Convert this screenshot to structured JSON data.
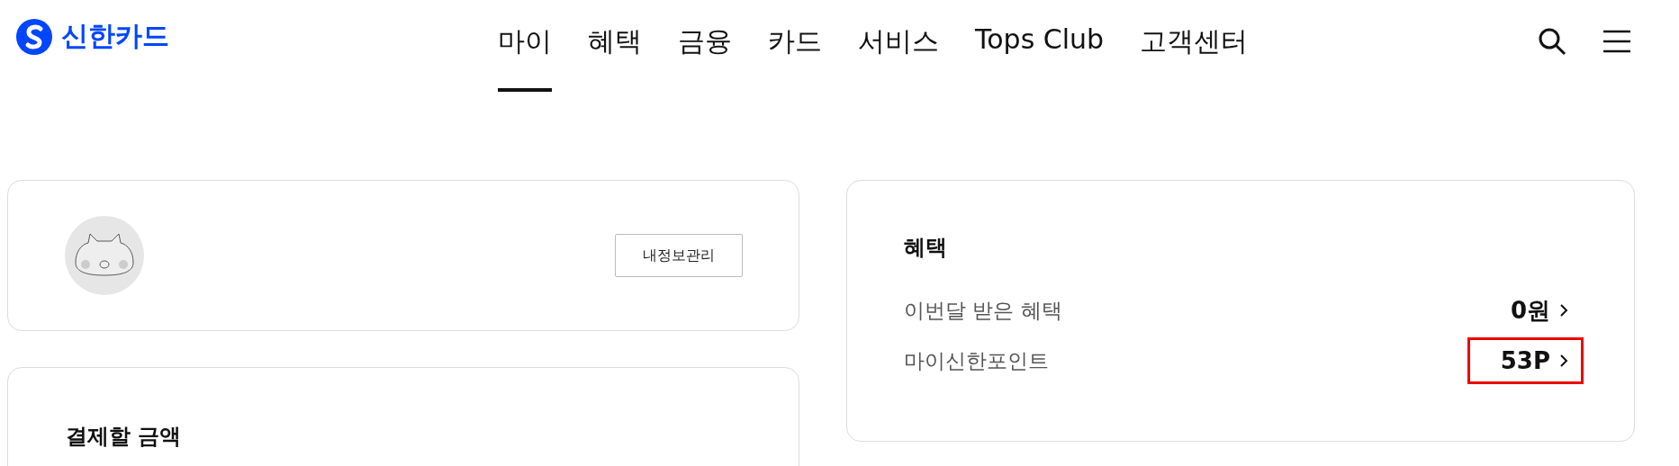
{
  "header": {
    "logo_text": "신한카드",
    "nav": [
      {
        "label": "마이",
        "selected": true
      },
      {
        "label": "혜택",
        "selected": false
      },
      {
        "label": "금융",
        "selected": false
      },
      {
        "label": "카드",
        "selected": false
      },
      {
        "label": "서비스",
        "selected": false
      },
      {
        "label": "Tops Club",
        "selected": false
      },
      {
        "label": "고객센터",
        "selected": false
      }
    ]
  },
  "profile_card": {
    "button": "내정보관리"
  },
  "payment_card": {
    "title": "결제할 금액"
  },
  "benefit_card": {
    "title": "혜택",
    "rows": [
      {
        "label": "이번달 받은 혜택",
        "value": "0원",
        "highlighted": false
      },
      {
        "label": "마이신한포인트",
        "value": "53P",
        "highlighted": true
      }
    ]
  }
}
